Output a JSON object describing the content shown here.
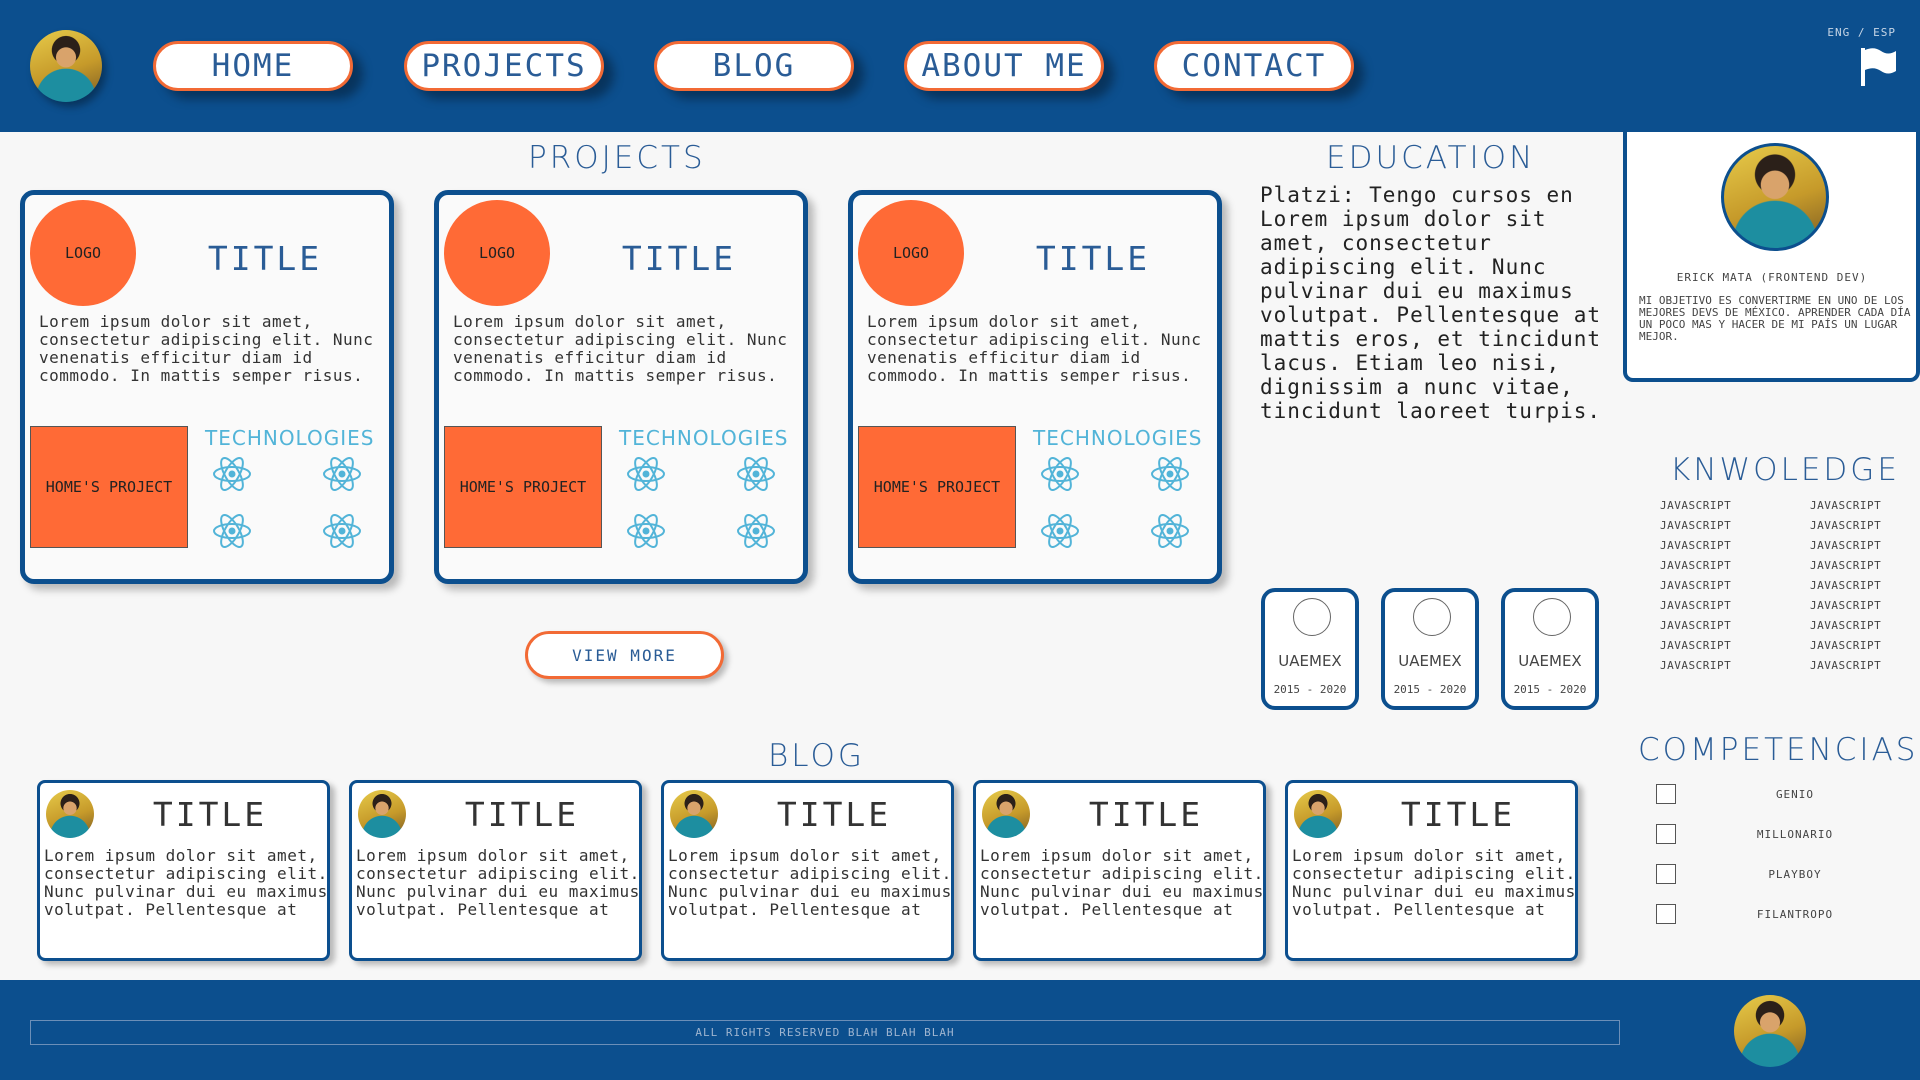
{
  "header": {
    "nav": [
      "HOME",
      "PROJECTS",
      "BLOG",
      "ABOUT ME",
      "CONTACT"
    ],
    "lang": "ENG / ESP"
  },
  "projects": {
    "title": "PROJECTS",
    "cards": [
      {
        "logo": "LOGO",
        "title": "TITLE",
        "desc": "Lorem ipsum dolor sit amet, consectetur adipiscing elit. Nunc venenatis efficitur diam id commodo. In mattis semper risus.",
        "image_label": "HOME'S PROJECT",
        "tech_label": "TECHNOLOGIES"
      },
      {
        "logo": "LOGO",
        "title": "TITLE",
        "desc": "Lorem ipsum dolor sit amet, consectetur adipiscing elit. Nunc venenatis efficitur diam id commodo. In mattis semper risus.",
        "image_label": "HOME'S PROJECT",
        "tech_label": "TECHNOLOGIES"
      },
      {
        "logo": "LOGO",
        "title": "TITLE",
        "desc": "Lorem ipsum dolor sit amet, consectetur adipiscing elit. Nunc venenatis efficitur diam id commodo. In mattis semper risus.",
        "image_label": "HOME'S PROJECT",
        "tech_label": "TECHNOLOGIES"
      }
    ],
    "view_more": "VIEW MORE"
  },
  "education": {
    "title": "EDUCATION",
    "text": "Platzi: Tengo cursos en Lorem ipsum dolor sit amet, consectetur adipiscing elit. Nunc pulvinar dui eu maximus volutpat. Pellentesque at mattis eros, et tincidunt lacus. Etiam leo nisi, dignissim a nunc vitae, tincidunt laoreet turpis.",
    "cards": [
      {
        "name": "UAEMEX",
        "years": "2015 - 2020"
      },
      {
        "name": "UAEMEX",
        "years": "2015 - 2020"
      },
      {
        "name": "UAEMEX",
        "years": "2015 - 2020"
      }
    ]
  },
  "profile": {
    "name": "ERICK MATA (FRONTEND DEV)",
    "desc": "MI OBJETIVO ES CONVERTIRME EN UNO DE LOS MEJORES DEVS DE MÉXICO. APRENDER CADA DÍA UN POCO MAS Y HACER DE MI PAÍS UN LUGAR MEJOR."
  },
  "knowledge": {
    "title": "KNWOLEDGE",
    "items": [
      "JAVASCRIPT",
      "JAVASCRIPT",
      "JAVASCRIPT",
      "JAVASCRIPT",
      "JAVASCRIPT",
      "JAVASCRIPT",
      "JAVASCRIPT",
      "JAVASCRIPT",
      "JAVASCRIPT",
      "JAVASCRIPT",
      "JAVASCRIPT",
      "JAVASCRIPT",
      "JAVASCRIPT",
      "JAVASCRIPT",
      "JAVASCRIPT",
      "JAVASCRIPT",
      "JAVASCRIPT",
      "JAVASCRIPT"
    ]
  },
  "competencias": {
    "title": "COMPETENCIAS",
    "items": [
      "GENIO",
      "MILLONARIO",
      "PLAYBOY",
      "FILANTROPO"
    ]
  },
  "blog": {
    "title": "BLOG",
    "cards": [
      {
        "title": "TITLE",
        "desc": "Lorem ipsum dolor sit amet, consectetur adipiscing elit. Nunc pulvinar dui eu maximus volutpat. Pellentesque at"
      },
      {
        "title": "TITLE",
        "desc": "Lorem ipsum dolor sit amet, consectetur adipiscing elit. Nunc pulvinar dui eu maximus volutpat. Pellentesque at"
      },
      {
        "title": "TITLE",
        "desc": "Lorem ipsum dolor sit amet, consectetur adipiscing elit. Nunc pulvinar dui eu maximus volutpat. Pellentesque at"
      },
      {
        "title": "TITLE",
        "desc": "Lorem ipsum dolor sit amet, consectetur adipiscing elit. Nunc pulvinar dui eu maximus volutpat. Pellentesque at"
      },
      {
        "title": "TITLE",
        "desc": "Lorem ipsum dolor sit amet, consectetur adipiscing elit. Nunc pulvinar dui eu maximus volutpat. Pellentesque at"
      }
    ]
  },
  "footer": {
    "text": "ALL RIGHTS RESERVED BLAH BLAH BLAH"
  },
  "icons": {
    "tech": "react-icon",
    "flag": "flag-icon"
  },
  "colors": {
    "primary": "#0c4f8e",
    "accent": "#ff6a36",
    "tech": "#52b4d8"
  }
}
